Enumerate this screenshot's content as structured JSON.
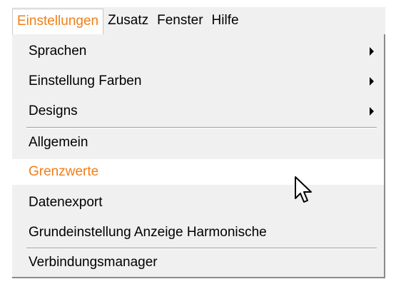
{
  "menubar": {
    "items": [
      {
        "label": "Einstellungen",
        "active": true
      },
      {
        "label": "Zusatz",
        "active": false
      },
      {
        "label": "Fenster",
        "active": false
      },
      {
        "label": "Hilfe",
        "active": false
      }
    ]
  },
  "dropdown": {
    "items": [
      {
        "label": "Sprachen",
        "submenu": true,
        "highlighted": false
      },
      {
        "label": "Einstellung Farben",
        "submenu": true,
        "highlighted": false
      },
      {
        "label": "Designs",
        "submenu": true,
        "highlighted": false
      },
      {
        "label": "Allgemein",
        "submenu": false,
        "highlighted": false
      },
      {
        "label": "Grenzwerte",
        "submenu": false,
        "highlighted": true
      },
      {
        "label": "Datenexport",
        "submenu": false,
        "highlighted": false
      },
      {
        "label": "Grundeinstellung Anzeige Harmonische",
        "submenu": false,
        "highlighted": false
      },
      {
        "label": "Verbindungsmanager",
        "submenu": false,
        "highlighted": false
      }
    ]
  },
  "colors": {
    "accent": "#ef7f1a",
    "menu_background": "#f0f0f0",
    "highlight_background": "#ffffff",
    "text": "#000000"
  },
  "icons": {
    "submenu_arrow": "triangle-right",
    "cursor": "arrow-pointer"
  }
}
